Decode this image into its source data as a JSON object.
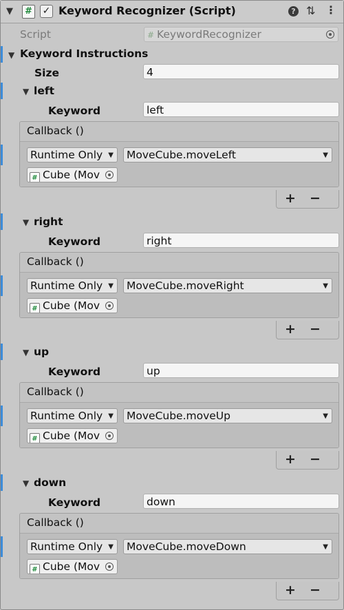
{
  "component": {
    "title": "Keyword Recognizer (Script)",
    "enabled_mark": "✓",
    "script_label": "Script",
    "script_value": "KeywordRecognizer",
    "help_icon": "?",
    "presets_icon": "⇅",
    "menu_icon": "⋮"
  },
  "instructions": {
    "label": "Keyword Instructions",
    "size_label": "Size",
    "size_value": "4",
    "items": [
      {
        "name": "left",
        "keyword_label": "Keyword",
        "keyword": "left",
        "callback_label": "Callback ()",
        "runtime": "Runtime Only",
        "function": "MoveCube.moveLeft",
        "object": "Cube (Mov"
      },
      {
        "name": "right",
        "keyword_label": "Keyword",
        "keyword": "right",
        "callback_label": "Callback ()",
        "runtime": "Runtime Only",
        "function": "MoveCube.moveRight",
        "object": "Cube (Mov"
      },
      {
        "name": "up",
        "keyword_label": "Keyword",
        "keyword": "up",
        "callback_label": "Callback ()",
        "runtime": "Runtime Only",
        "function": "MoveCube.moveUp",
        "object": "Cube (Mov"
      },
      {
        "name": "down",
        "keyword_label": "Keyword",
        "keyword": "down",
        "callback_label": "Callback ()",
        "runtime": "Runtime Only",
        "function": "MoveCube.moveDown",
        "object": "Cube (Mov"
      }
    ]
  },
  "buttons": {
    "plus": "+",
    "minus": "−"
  },
  "colors": {
    "accent": "#3d8cd9",
    "script_icon_green": "#208a3c"
  }
}
